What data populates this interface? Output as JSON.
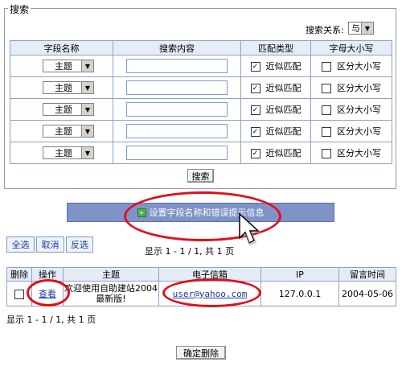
{
  "search_panel": {
    "legend": "搜索",
    "relation_label": "搜索关系:",
    "relation_value": "与",
    "headers": [
      "字段名称",
      "搜索内容",
      "匹配类型",
      "字母大小写"
    ],
    "rows": [
      {
        "field": "主题",
        "content": "",
        "fuzzy_checked": true,
        "fuzzy_label": "近似匹配",
        "case_checked": false,
        "case_label": "区分大小写"
      },
      {
        "field": "主题",
        "content": "",
        "fuzzy_checked": true,
        "fuzzy_label": "近似匹配",
        "case_checked": false,
        "case_label": "区分大小写"
      },
      {
        "field": "主题",
        "content": "",
        "fuzzy_checked": true,
        "fuzzy_label": "近似匹配",
        "case_checked": false,
        "case_label": "区分大小写"
      },
      {
        "field": "主题",
        "content": "",
        "fuzzy_checked": true,
        "fuzzy_label": "近似匹配",
        "case_checked": false,
        "case_label": "区分大小写"
      },
      {
        "field": "主题",
        "content": "",
        "fuzzy_checked": true,
        "fuzzy_label": "近似匹配",
        "case_checked": false,
        "case_label": "区分大小写"
      }
    ],
    "search_button": "搜索"
  },
  "banner": {
    "label": "设置字段名称和错误提示信息",
    "icon": "plus-icon"
  },
  "actions": {
    "select_all": "全选",
    "cancel": "取消",
    "invert": "反选"
  },
  "paging_top": "显示 1 - 1 / 1, 共 1 页",
  "results": {
    "headers": [
      "删除",
      "操作",
      "主题",
      "电子信箱",
      "IP",
      "留言时间"
    ],
    "rows": [
      {
        "checked": false,
        "action": "查看",
        "subject": "欢迎使用自助建站2004最新版!",
        "email": "user@yahoo.com",
        "ip": "127.0.0.1",
        "time": "2004-05-06"
      }
    ]
  },
  "paging_bottom": "显示 1 - 1 / 1, 共 1 页",
  "confirm_delete": "确定删除",
  "colors": {
    "annotation": "#e0101a",
    "banner": "#7f93c8",
    "link": "#1a3aa0"
  }
}
